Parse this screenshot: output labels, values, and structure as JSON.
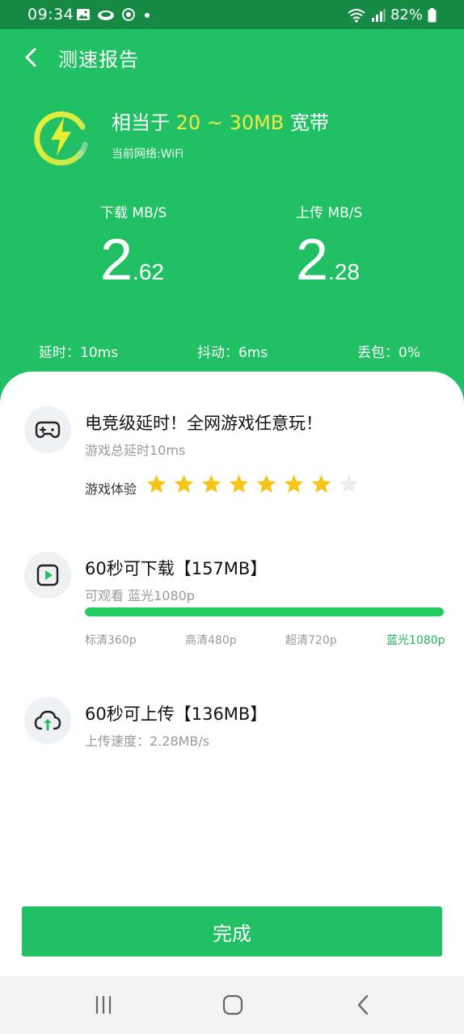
{
  "status_bar": {
    "time": "09:34",
    "battery": "82%",
    "left_icons": [
      "image-icon",
      "cloud-icon",
      "sync-icon",
      "dot-icon"
    ],
    "right_icons": [
      "wifi-icon",
      "signal-icon",
      "battery-icon"
    ]
  },
  "header": {
    "title": "测速报告",
    "bandwidth_prefix": "相当于",
    "bandwidth_range": "20 ~ 30MB",
    "bandwidth_suffix": "宽带",
    "network": "当前网络:WiFi",
    "download": {
      "label": "下载 MB/S",
      "int": "2",
      "dec": ".62"
    },
    "upload": {
      "label": "上传 MB/S",
      "int": "2",
      "dec": ".28"
    },
    "latency": "延时：10ms",
    "jitter": "抖动：6ms",
    "packet_loss": "丢包：0%"
  },
  "game": {
    "title": "电竞级延时！全网游戏任意玩！",
    "subtitle": "游戏总延时10ms",
    "experience_label": "游戏体验",
    "stars_filled": 7,
    "stars_total": 8
  },
  "download_card": {
    "title": "60秒可下载【157MB】",
    "subtitle": "可观看 蓝光1080p",
    "progress": 1.0,
    "qualities": [
      "标清360p",
      "高清480p",
      "超清720p",
      "蓝光1080p"
    ],
    "active_quality_index": 3
  },
  "upload_card": {
    "title": "60秒可上传【136MB】",
    "subtitle": "上传速度：2.28MB/s"
  },
  "done_button": "完成",
  "colors": {
    "brand_green": "#21c064",
    "status_green": "#168a44",
    "highlight_yellow": "#f2ea45",
    "star_gold": "#f5c518",
    "progress_green": "#21cc5c"
  }
}
